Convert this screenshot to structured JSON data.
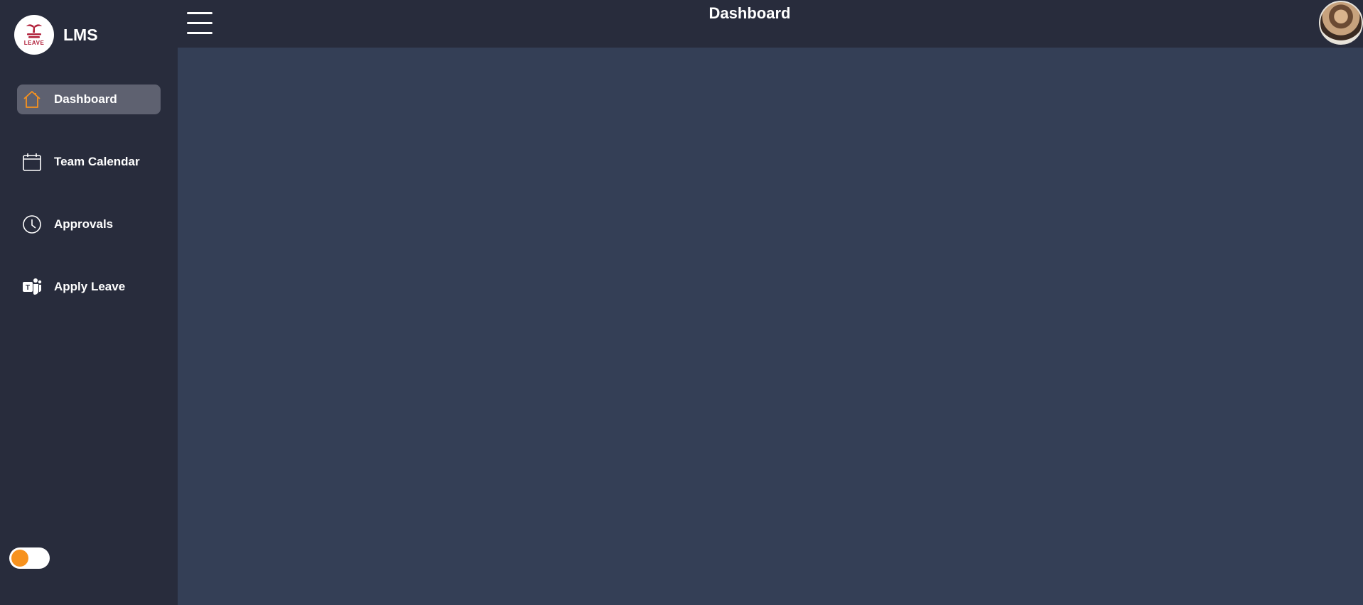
{
  "brand": {
    "name": "LMS",
    "logo_text": "LEAVE"
  },
  "header": {
    "title": "Dashboard"
  },
  "sidebar": {
    "items": [
      {
        "label": "Dashboard",
        "icon": "home-icon",
        "active": true
      },
      {
        "label": "Team Calendar",
        "icon": "calendar-icon",
        "active": false
      },
      {
        "label": "Approvals",
        "icon": "clock-icon",
        "active": false
      },
      {
        "label": "Apply Leave",
        "icon": "teams-icon",
        "active": false
      }
    ]
  },
  "theme_toggle": {
    "on": false
  },
  "colors": {
    "sidebar_bg": "#282c3c",
    "main_bg": "#343f56",
    "active_item_bg": "#5e6170",
    "accent": "#f7921e",
    "logo_red": "#b1203a"
  }
}
